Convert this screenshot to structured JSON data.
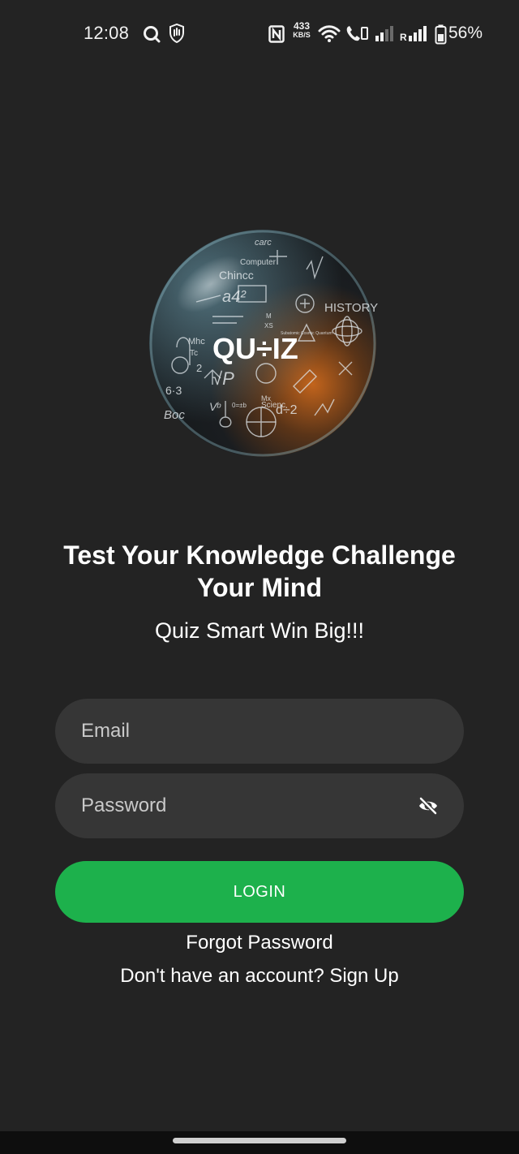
{
  "status_bar": {
    "time": "12:08",
    "net_speed_value": "433",
    "net_speed_unit": "KB/S",
    "battery_percent": "56%",
    "signal_label": "R"
  },
  "logo": {
    "title": "QU÷IZ",
    "icon": "quiz-globe-logo"
  },
  "headline": "Test Your Knowledge Challenge Your Mind",
  "tagline": "Quiz Smart Win Big!!!",
  "form": {
    "email_placeholder": "Email",
    "password_placeholder": "Password",
    "login_label": "LOGIN",
    "forgot_label": "Forgot Password",
    "signup_label": "Don't have an account? Sign Up"
  },
  "colors": {
    "background": "#232323",
    "field_bg": "#363636",
    "accent": "#1db14c"
  }
}
